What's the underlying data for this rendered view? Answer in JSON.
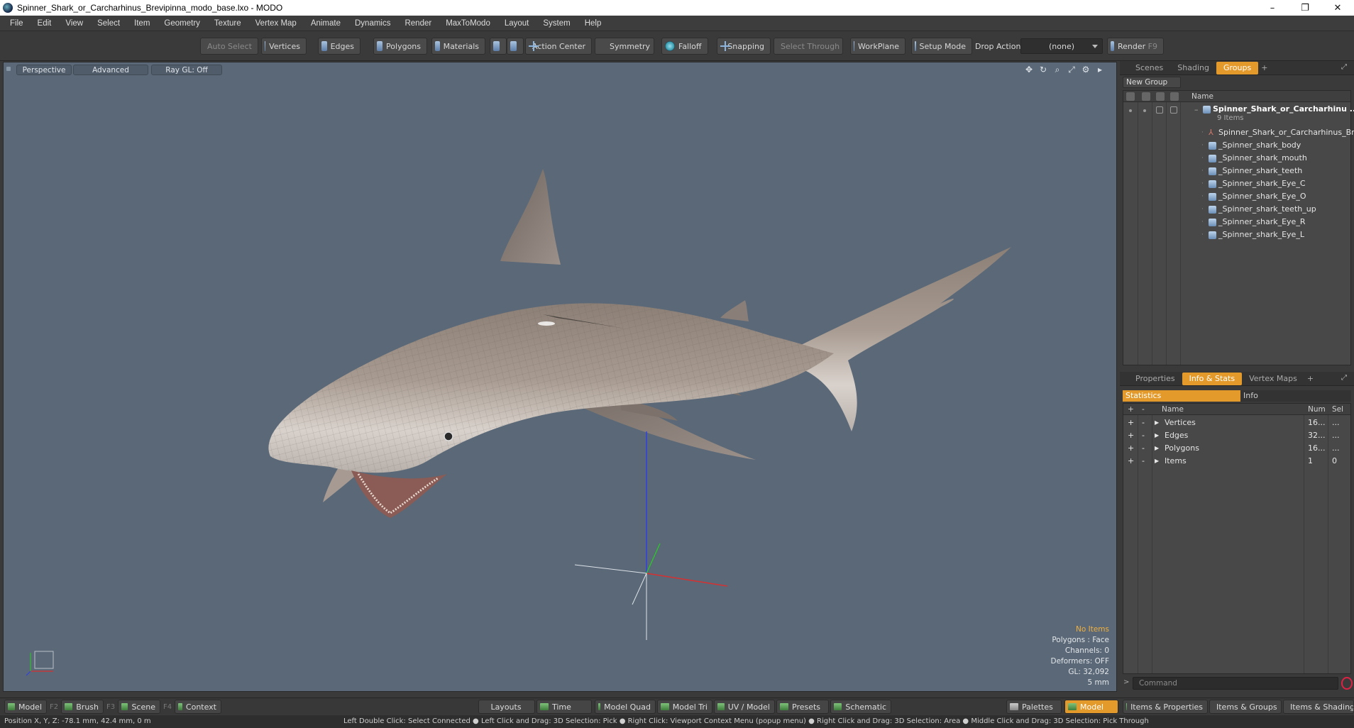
{
  "window": {
    "title": "Spinner_Shark_or_Carcharhinus_Brevipinna_modo_base.lxo - MODO",
    "minimize": "–",
    "restore": "❐",
    "close": "✕"
  },
  "menu": [
    "File",
    "Edit",
    "View",
    "Select",
    "Item",
    "Geometry",
    "Texture",
    "Vertex Map",
    "Animate",
    "Dynamics",
    "Render",
    "MaxToModo",
    "Layout",
    "System",
    "Help"
  ],
  "toolbar": {
    "auto_select": "Auto Select",
    "vertices": "Vertices",
    "edges": "Edges",
    "polygons": "Polygons",
    "materials": "Materials",
    "action_center": "Action Center",
    "symmetry": "Symmetry",
    "falloff": "Falloff",
    "snapping": "Snapping",
    "select_through": "Select Through",
    "workplane": "WorkPlane",
    "setup_mode": "Setup Mode",
    "drop_action_label": "Drop Action",
    "drop_action_value": "(none)",
    "render": "Render",
    "render_key": "F9"
  },
  "viewport": {
    "view": "Perspective",
    "shading": "Advanced",
    "raygl": "Ray GL: Off",
    "info": {
      "items": "No Items",
      "polygons": "Polygons : Face",
      "channels": "Channels: 0",
      "deformers": "Deformers: OFF",
      "gl": "GL: 32,092",
      "unit": "5 mm"
    }
  },
  "groups_panel": {
    "tabs": [
      "Scenes",
      "Shading",
      "Groups"
    ],
    "active_tab": "Groups",
    "new_group": "New Group",
    "name_header": "Name",
    "root": "Spinner_Shark_or_Carcharhinu ...",
    "root_count": "9 Items",
    "children": [
      "Spinner_Shark_or_Carcharhinus_Br...",
      "_Spinner_shark_body",
      "_Spinner_shark_mouth",
      "_Spinner_shark_teeth",
      "_Spinner_shark_Eye_C",
      "_Spinner_shark_Eye_O",
      "_Spinner_shark_teeth_up",
      "_Spinner_shark_Eye_R",
      "_Spinner_shark_Eye_L"
    ]
  },
  "stats_panel": {
    "tabs": [
      "Properties",
      "Info & Stats",
      "Vertex Maps"
    ],
    "active_tab": "Info & Stats",
    "sub_tabs": [
      "Statistics",
      "Info"
    ],
    "headers": {
      "plus": "+",
      "minus": "-",
      "name": "Name",
      "num": "Num",
      "sel": "Sel"
    },
    "rows": [
      {
        "name": "Vertices",
        "num": "16...",
        "sel": "..."
      },
      {
        "name": "Edges",
        "num": "32...",
        "sel": "..."
      },
      {
        "name": "Polygons",
        "num": "16...",
        "sel": "..."
      },
      {
        "name": "Items",
        "num": "1",
        "sel": "0"
      }
    ],
    "command_placeholder": "Command"
  },
  "bottom": {
    "model": "Model",
    "model_key": "F2",
    "brush": "Brush",
    "brush_key": "F3",
    "scene": "Scene",
    "scene_key": "F4",
    "context": "Context",
    "layouts": "Layouts",
    "time": "Time",
    "model_quad": "Model Quad",
    "model_tri": "Model Tri",
    "uv_model": "UV / Model",
    "presets": "Presets",
    "schematic": "Schematic",
    "palettes": "Palettes",
    "model_active": "Model",
    "items_properties": "Items & Properties",
    "items_groups": "Items & Groups",
    "items_shading": "Items & Shading"
  },
  "status": {
    "position": "Position X, Y, Z:   -78.1 mm, 42.4 mm, 0 m",
    "hint": "Left Double Click: Select Connected ● Left Click and Drag: 3D Selection: Pick ● Right Click: Viewport Context Menu (popup menu) ● Right Click and Drag: 3D Selection: Area ● Middle Click and Drag: 3D Selection: Pick Through"
  },
  "colors": {
    "accent": "#e39a2b",
    "viewport_bg": "#5a6877",
    "axis_x": "#d83030",
    "axis_y": "#30c030",
    "axis_z": "#3040e0"
  }
}
